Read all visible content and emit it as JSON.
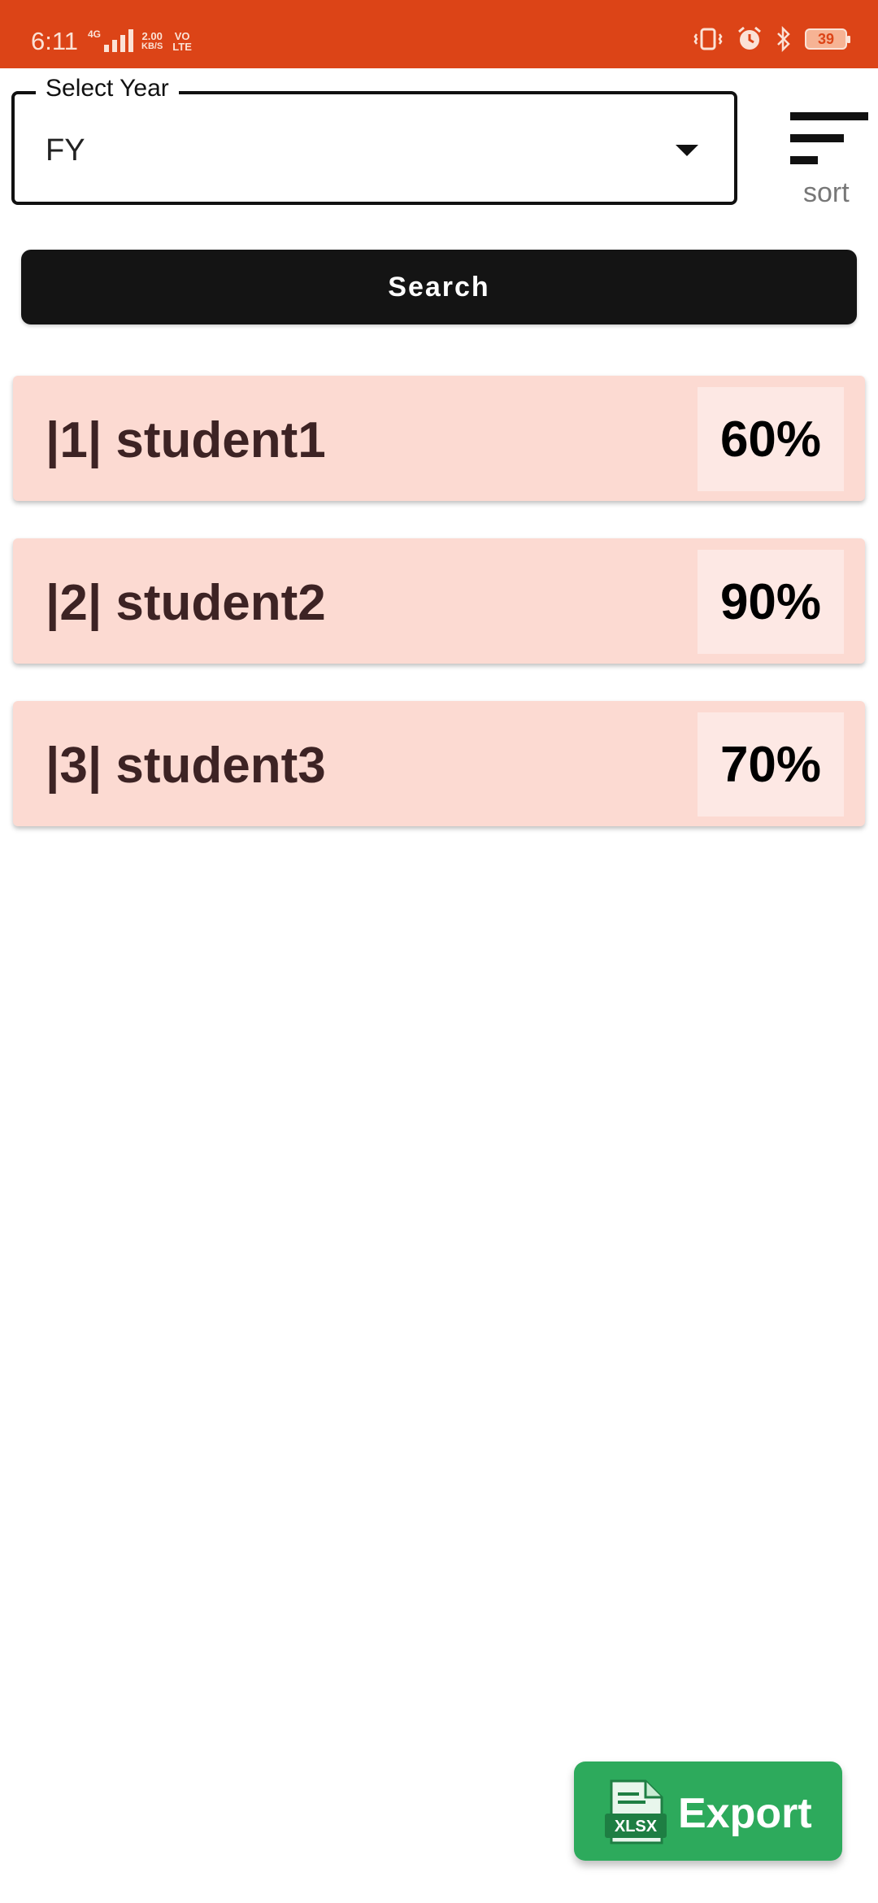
{
  "status_bar": {
    "time": "6:11",
    "network_type": "4G",
    "speed_value": "2.00",
    "speed_unit": "KB/S",
    "volte_top": "VO",
    "volte_bottom": "LTE",
    "battery": "39",
    "icons": [
      "vibrate-icon",
      "alarm-icon",
      "bluetooth-icon",
      "battery-icon"
    ]
  },
  "filter": {
    "label": "Select Year",
    "selected": "FY",
    "sort_label": "sort"
  },
  "search": {
    "label": "Search"
  },
  "students": [
    {
      "name": "|1|  student1",
      "score": "60%"
    },
    {
      "name": "|2|  student2",
      "score": "90%"
    },
    {
      "name": "|3|  student3",
      "score": "70%"
    }
  ],
  "export": {
    "label": "Export",
    "icon_text": "XLSX"
  },
  "colors": {
    "status_bar": "#dc4417",
    "list_item": "#fcdad2",
    "score_box": "#fde8e4",
    "export_button": "#2daa5c",
    "search_button": "#141414"
  }
}
